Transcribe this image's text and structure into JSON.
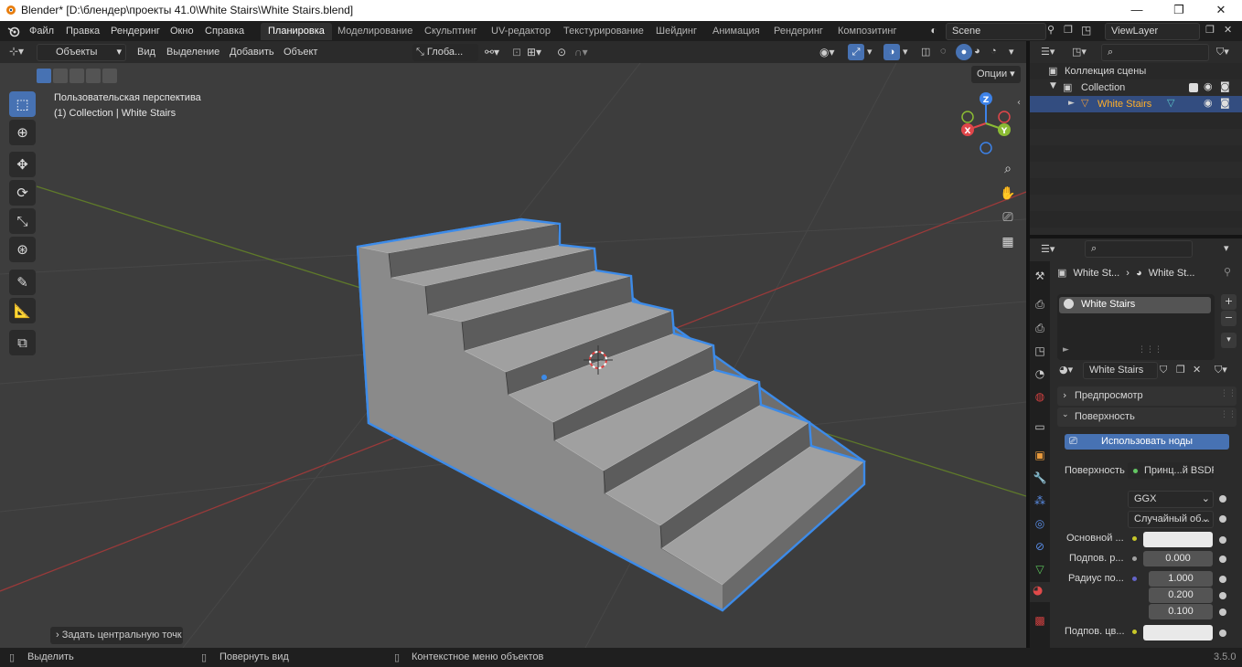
{
  "window": {
    "title": "Blender* [D:\\блендер\\проекты 41.0\\White Stairs\\White Stairs.blend]",
    "minimize": "—",
    "maximize": "❐",
    "close": "✕"
  },
  "menu": [
    "Файл",
    "Правка",
    "Рендеринг",
    "Окно",
    "Справка"
  ],
  "workspaces": [
    "Планировка",
    "Моделирование",
    "Скульптинг",
    "UV-редактор",
    "Текстурирование",
    "Шейдинг",
    "Анимация",
    "Рендеринг",
    "Композитинг"
  ],
  "scene": {
    "name": "Scene",
    "view_layer": "ViewLayer"
  },
  "viewport_header": {
    "mode": "Объекты",
    "items": [
      "Вид",
      "Выделение",
      "Добавить",
      "Объект"
    ],
    "transform": "Глоба...",
    "options": "Опции"
  },
  "viewport": {
    "view_name": "Пользовательская перспектива",
    "collection_info": "(1) Collection | White Stairs",
    "last_op": "Задать центральную точк"
  },
  "gizmo": {
    "x": "X",
    "y": "Y",
    "z": "Z"
  },
  "outliner": {
    "root": "Коллекция сцены",
    "collection": "Collection",
    "object": "White Stairs"
  },
  "props": {
    "breadcrumb_obj": "White St...",
    "breadcrumb_mat": "White St...",
    "slot": "White Stairs",
    "material": "White Stairs",
    "section_preview": "Предпросмотр",
    "section_surface": "Поверхность",
    "use_nodes": "Использовать ноды",
    "surface_label": "Поверхность",
    "surface_value": "Принц...й BSDF",
    "distribution": "GGX",
    "subsurface_method": "Случайный об...",
    "base_color_label": "Основной ...",
    "subsurface_label": "Подпов. р...",
    "subsurface_value": "0.000",
    "radius_label": "Радиус по...",
    "radius": [
      "1.000",
      "0.200",
      "0.100"
    ],
    "subsurface_color_label": "Подпов. цв..."
  },
  "status": {
    "select": "Выделить",
    "rotate": "Повернуть вид",
    "context": "Контекстное меню объектов",
    "version": "3.5.0"
  },
  "colors": {
    "accent": "#4772b3",
    "selection_outline": "#3d8be8",
    "x_axis": "#e0464a",
    "y_axis": "#8bbb34",
    "z_axis": "#3d82e8"
  }
}
